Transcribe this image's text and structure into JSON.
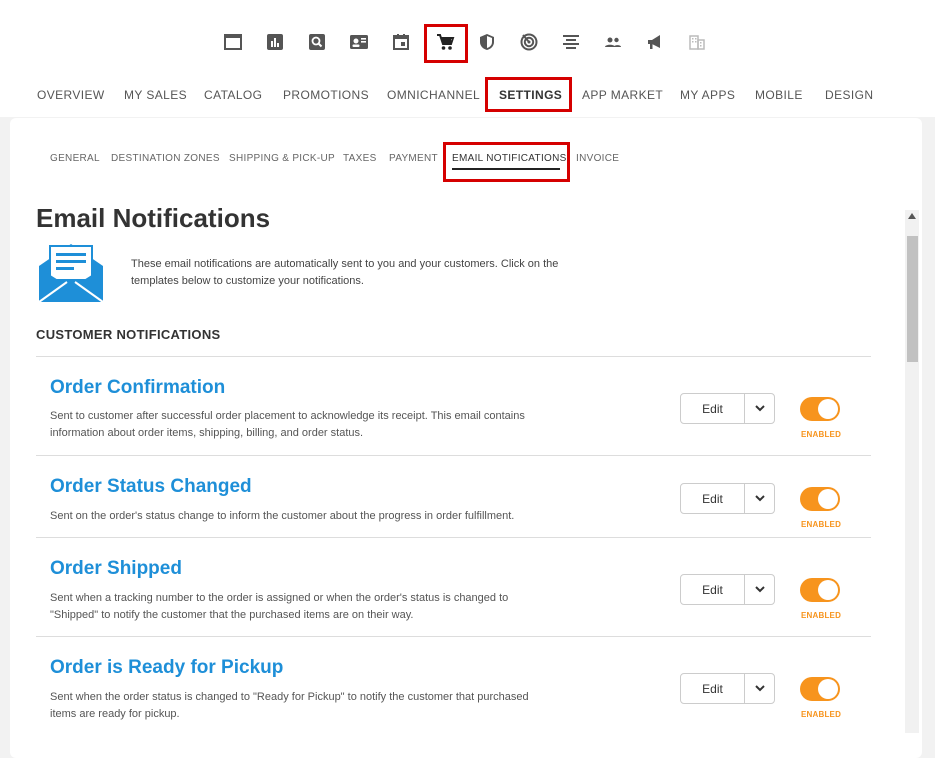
{
  "icon_bar": {
    "items": [
      {
        "name": "window-icon"
      },
      {
        "name": "chart-icon"
      },
      {
        "name": "search-icon"
      },
      {
        "name": "contact-card-icon"
      },
      {
        "name": "calendar-icon"
      },
      {
        "name": "shopping-cart-icon",
        "selected": true
      },
      {
        "name": "shield-icon"
      },
      {
        "name": "radar-icon"
      },
      {
        "name": "align-center-icon"
      },
      {
        "name": "people-icon"
      },
      {
        "name": "megaphone-icon"
      },
      {
        "name": "building-icon"
      }
    ]
  },
  "main_nav": {
    "items": [
      "OVERVIEW",
      "MY SALES",
      "CATALOG",
      "PROMOTIONS",
      "OMNICHANNEL",
      "SETTINGS",
      "APP MARKET",
      "MY APPS",
      "MOBILE",
      "DESIGN"
    ],
    "active": "SETTINGS"
  },
  "sub_nav": {
    "items": [
      "GENERAL",
      "DESTINATION ZONES",
      "SHIPPING & PICK-UP",
      "TAXES",
      "PAYMENT",
      "EMAIL NOTIFICATIONS",
      "INVOICE"
    ],
    "active": "EMAIL NOTIFICATIONS"
  },
  "page": {
    "title": "Email Notifications",
    "intro": "These email notifications are automatically sent to you and your customers. Click on the templates below to customize your notifications.",
    "section_title": "CUSTOMER NOTIFICATIONS"
  },
  "notifications": [
    {
      "title": "Order Confirmation",
      "description": "Sent to customer after successful order placement to acknowledge its receipt. This email contains information about order items, shipping, billing, and order status.",
      "edit_label": "Edit",
      "status": "ENABLED"
    },
    {
      "title": "Order Status Changed",
      "description": "Sent on the order's status change to inform the customer about the progress in order fulfillment.",
      "edit_label": "Edit",
      "status": "ENABLED"
    },
    {
      "title": "Order Shipped",
      "description": "Sent when a tracking number to the order is assigned or when the order's status is changed to \"Shipped\" to notify the customer that the purchased items are on their way.",
      "edit_label": "Edit",
      "status": "ENABLED"
    },
    {
      "title": "Order is Ready for Pickup",
      "description": "Sent when the order status is changed to \"Ready for Pickup\" to notify the customer that purchased items are ready for pickup.",
      "edit_label": "Edit",
      "status": "ENABLED"
    }
  ],
  "colors": {
    "accent": "#1e8fd8",
    "toggle_on": "#f7941d",
    "highlight_box": "#d50000"
  }
}
